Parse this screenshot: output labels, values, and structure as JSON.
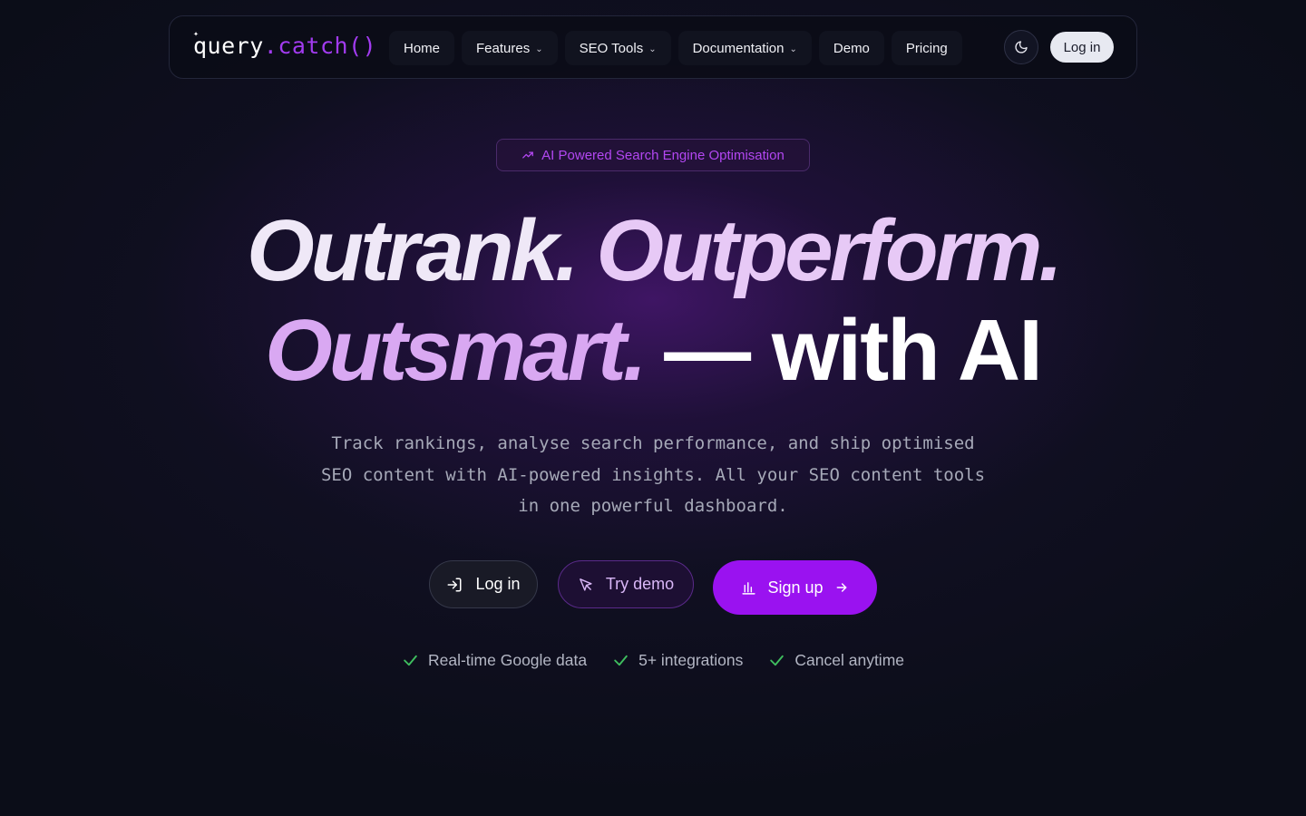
{
  "logo": {
    "part_a": "query",
    "part_b": ".catch()"
  },
  "nav": {
    "items": [
      {
        "label": "Home",
        "dropdown": false
      },
      {
        "label": "Features",
        "dropdown": true
      },
      {
        "label": "SEO Tools",
        "dropdown": true
      },
      {
        "label": "Documentation",
        "dropdown": true
      },
      {
        "label": "Demo",
        "dropdown": false
      },
      {
        "label": "Pricing",
        "dropdown": false
      }
    ],
    "theme_toggle_icon": "moon-icon",
    "login_label": "Log in"
  },
  "badge": {
    "icon": "trending-up-icon",
    "label": "AI Powered Search Engine Optimisation"
  },
  "headline": {
    "word1": "Outrank.",
    "word2": "Outperform.",
    "word3": "Outsmart.",
    "tail": "— with AI"
  },
  "subtext": {
    "line1": "Track rankings, analyse search performance, and ship optimised",
    "line2": "SEO content with AI-powered insights. All your SEO content tools",
    "line3": "in one powerful dashboard."
  },
  "cta": {
    "login": {
      "label": "Log in",
      "icon": "log-in-icon"
    },
    "demo": {
      "label": "Try demo",
      "icon": "cursor-icon"
    },
    "signup": {
      "label": "Sign up",
      "icon": "bar-chart-icon",
      "trailing_icon": "arrow-right-icon"
    }
  },
  "features": [
    {
      "label": "Real-time Google data",
      "icon": "check-icon"
    },
    {
      "label": "5+ integrations",
      "icon": "check-icon"
    },
    {
      "label": "Cancel anytime",
      "icon": "check-icon"
    }
  ],
  "colors": {
    "background": "#0b0d18",
    "accent": "#9a12f0",
    "badge_text": "#b347f2",
    "check": "#3fbf5f"
  }
}
